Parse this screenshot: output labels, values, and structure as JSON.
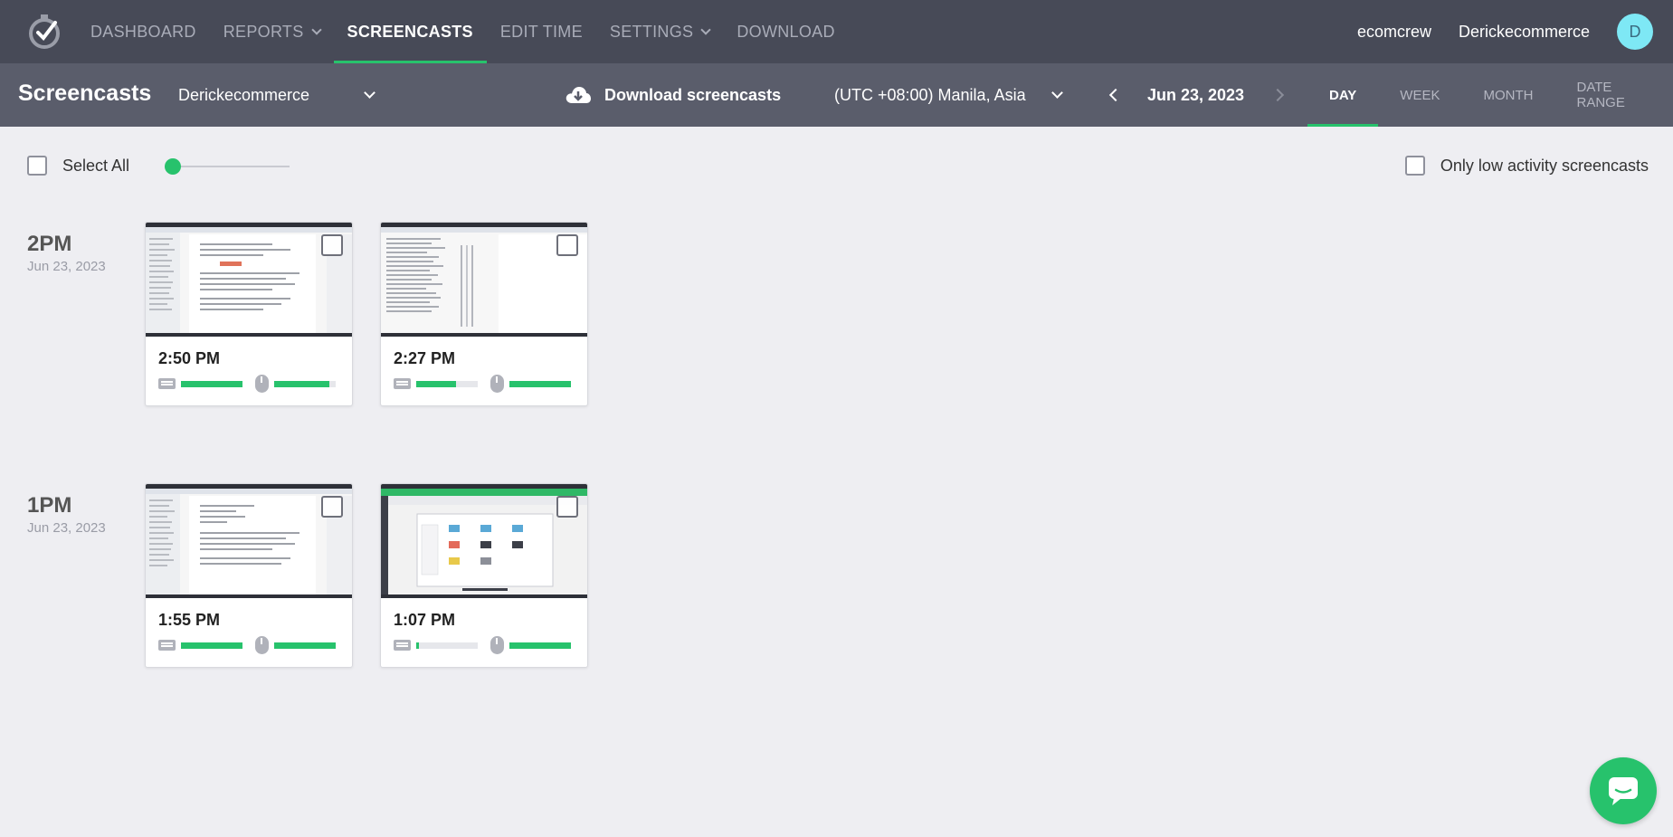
{
  "nav": {
    "items": [
      {
        "label": "DASHBOARD",
        "dropdown": false,
        "active": false
      },
      {
        "label": "REPORTS",
        "dropdown": true,
        "active": false
      },
      {
        "label": "SCREENCASTS",
        "dropdown": false,
        "active": true
      },
      {
        "label": "EDIT TIME",
        "dropdown": false,
        "active": false
      },
      {
        "label": "SETTINGS",
        "dropdown": true,
        "active": false
      },
      {
        "label": "DOWNLOAD",
        "dropdown": false,
        "active": false
      }
    ],
    "org": "ecomcrew",
    "user": "Derickecommerce",
    "avatar_letter": "D"
  },
  "subbar": {
    "title": "Screencasts",
    "user_select": "Derickecommerce",
    "download_label": "Download screencasts",
    "timezone": "(UTC +08:00) Manila, Asia",
    "date": "Jun 23, 2023",
    "ranges": [
      {
        "label": "DAY",
        "active": true
      },
      {
        "label": "WEEK",
        "active": false
      },
      {
        "label": "MONTH",
        "active": false
      },
      {
        "label": "DATE RANGE",
        "active": false
      }
    ]
  },
  "toolbar": {
    "select_all": "Select All",
    "low_activity": "Only low activity screencasts",
    "slider_value": 0
  },
  "groups": [
    {
      "hour": "2PM",
      "date": "Jun 23, 2023",
      "cards": [
        {
          "time": "2:50 PM",
          "keyboard": 1.0,
          "mouse": 0.9,
          "thumb": "doc"
        },
        {
          "time": "2:27 PM",
          "keyboard": 0.65,
          "mouse": 1.0,
          "thumb": "list"
        }
      ]
    },
    {
      "hour": "1PM",
      "date": "Jun 23, 2023",
      "cards": [
        {
          "time": "1:55 PM",
          "keyboard": 1.0,
          "mouse": 1.0,
          "thumb": "doc"
        },
        {
          "time": "1:07 PM",
          "keyboard": 0.04,
          "mouse": 1.0,
          "thumb": "app"
        }
      ]
    }
  ],
  "colors": {
    "accent": "#27c26c",
    "nav_bg": "#474a57",
    "subbar_bg": "#5a5d6b"
  }
}
